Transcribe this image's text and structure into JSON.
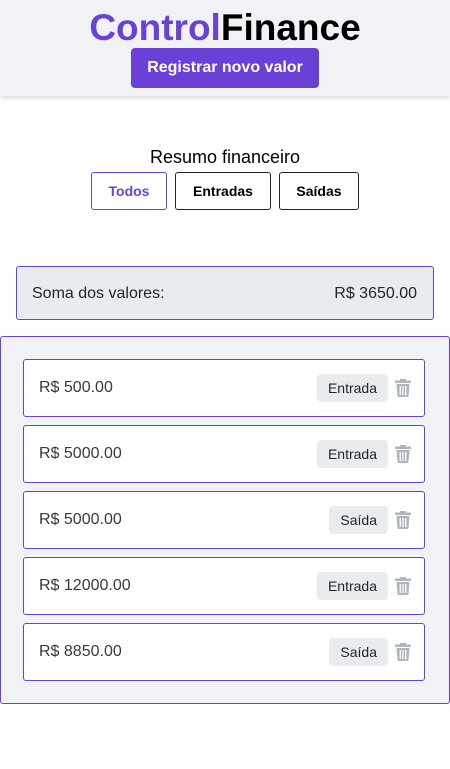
{
  "header": {
    "logo_part1": "Control",
    "logo_part2": "Finance",
    "register_button": "Registrar novo valor"
  },
  "summary": {
    "title": "Resumo financeiro",
    "filters": [
      {
        "label": "Todos",
        "active": true
      },
      {
        "label": "Entradas",
        "active": false
      },
      {
        "label": "Saídas",
        "active": false
      }
    ],
    "sum_label": "Soma dos valores:",
    "sum_value": "R$ 3650.00"
  },
  "entries": [
    {
      "value": "R$ 500.00",
      "type": "Entrada"
    },
    {
      "value": "R$ 5000.00",
      "type": "Entrada"
    },
    {
      "value": "R$ 5000.00",
      "type": "Saída"
    },
    {
      "value": "R$ 12000.00",
      "type": "Entrada"
    },
    {
      "value": "R$ 8850.00",
      "type": "Saída"
    }
  ],
  "icons": {
    "delete": "trash-icon"
  },
  "colors": {
    "brand": "#6a41d6",
    "header_bg": "#f1f2f5",
    "badge_bg": "#e9ecef",
    "icon_gray": "#adb5bd"
  }
}
